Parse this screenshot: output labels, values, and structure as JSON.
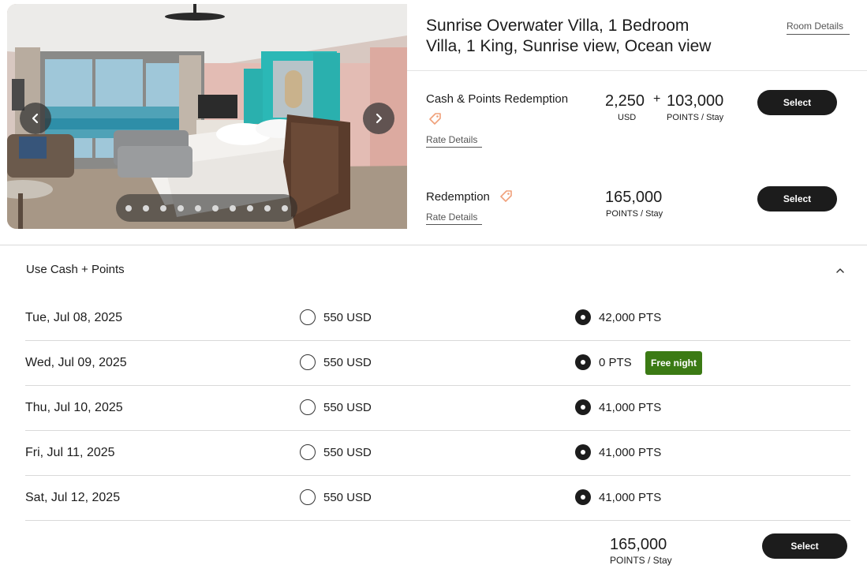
{
  "room": {
    "title_line1": "Sunrise Overwater Villa, 1 Bedroom",
    "title_line2": "Villa, 1 King, Sunrise view, Ocean view",
    "details_link": "Room Details"
  },
  "gallery": {
    "prev_icon": "chevron-left-icon",
    "next_icon": "chevron-right-icon",
    "image_count": 10,
    "active_index": 0
  },
  "rates": [
    {
      "name": "Cash & Points Redemption",
      "tag_icon": "tag-icon",
      "link": "Rate Details",
      "cash_amount": "2,250",
      "cash_unit": "USD",
      "plus": "+",
      "points_amount": "103,000",
      "points_unit": "POINTS / Stay",
      "button": "Select"
    },
    {
      "name": "Redemption",
      "tag_icon": "tag-icon",
      "link": "Rate Details",
      "points_amount": "165,000",
      "points_unit": "POINTS / Stay",
      "button": "Select"
    }
  ],
  "cash_points": {
    "title": "Use Cash + Points",
    "collapse_icon": "chevron-up-icon",
    "nights": [
      {
        "date": "Tue, Jul 08, 2025",
        "cash": "550 USD",
        "points": "42,000 PTS",
        "selected": "points",
        "badge": ""
      },
      {
        "date": "Wed, Jul 09, 2025",
        "cash": "550 USD",
        "points": "0 PTS",
        "selected": "points",
        "badge": "Free night"
      },
      {
        "date": "Thu, Jul 10, 2025",
        "cash": "550 USD",
        "points": "41,000 PTS",
        "selected": "points",
        "badge": ""
      },
      {
        "date": "Fri, Jul 11, 2025",
        "cash": "550 USD",
        "points": "41,000 PTS",
        "selected": "points",
        "badge": ""
      },
      {
        "date": "Sat, Jul 12, 2025",
        "cash": "550 USD",
        "points": "41,000 PTS",
        "selected": "points",
        "badge": ""
      }
    ],
    "total_points": "165,000",
    "total_unit": "POINTS / Stay",
    "button": "Select"
  },
  "colors": {
    "primary_button": "#1c1c1c",
    "free_night_badge": "#3b7a14",
    "tag_accent": "#f0a07a"
  }
}
